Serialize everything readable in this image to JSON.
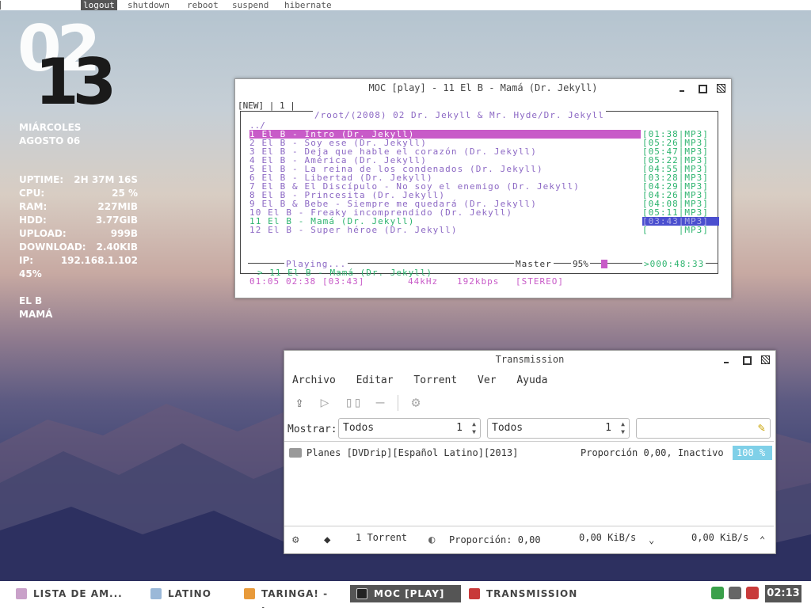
{
  "topbar": {
    "items": [
      {
        "label": "logout",
        "active": true
      },
      {
        "label": "shutdown",
        "active": false
      },
      {
        "label": "reboot",
        "active": false
      },
      {
        "label": "suspend",
        "active": false
      },
      {
        "label": "hibernate",
        "active": false
      }
    ]
  },
  "conky": {
    "hour": "02",
    "minute": "13",
    "weekday": "MIÁRCOLES",
    "date": "AGOSTO 06",
    "stats": [
      {
        "key": "UPTIME:",
        "value": "2H 37M 16S"
      },
      {
        "key": "CPU:",
        "value": "25 %"
      },
      {
        "key": "RAM:",
        "value": "227MIB"
      },
      {
        "key": "HDD:",
        "value": "3.77GIB"
      },
      {
        "key": "UPLOAD:",
        "value": "999B"
      },
      {
        "key": "DOWNLOAD:",
        "value": "2.40KIB"
      },
      {
        "key": "IP:",
        "value": "192.168.1.102"
      }
    ],
    "volume": "45%",
    "artist": "EL B",
    "song": "MAMÁ"
  },
  "moc": {
    "title": "MOC [play] - 11 El B - Mamá (Dr. Jekyll)",
    "header_left": "[NEW] | 1 |",
    "path": "/root/(2008) 02 Dr. Jekyll & Mr. Hyde/Dr. Jekyll",
    "parent_dir": "../",
    "tracks": [
      {
        "name": "1 El B - Intro (Dr. Jekyll)",
        "info": "[01:38|MP3]",
        "state": "selected"
      },
      {
        "name": "2 El B - Soy ese (Dr. Jekyll)",
        "info": "[05:26|MP3]",
        "state": ""
      },
      {
        "name": "3 El B - Deja que hable el corazón (Dr. Jekyll)",
        "info": "[05:47|MP3]",
        "state": ""
      },
      {
        "name": "4 El B - América (Dr. Jekyll)",
        "info": "[05:22|MP3]",
        "state": ""
      },
      {
        "name": "5 El B - La reina de los condenados (Dr. Jekyll)",
        "info": "[04:55|MP3]",
        "state": ""
      },
      {
        "name": "6 El B - Libertad (Dr. Jekyll)",
        "info": "[03:28|MP3]",
        "state": ""
      },
      {
        "name": "7 El B & El Discípulo - No soy el enemigo (Dr. Jekyll)",
        "info": "[04:29|MP3]",
        "state": ""
      },
      {
        "name": "8 El B - Princesita (Dr. Jekyll)",
        "info": "[04:26|MP3]",
        "state": ""
      },
      {
        "name": "9 El B & Bebe - Siempre me quedará (Dr. Jekyll)",
        "info": "[04:08|MP3]",
        "state": ""
      },
      {
        "name": "10 El B - Freaky incomprendido (Dr. Jekyll)",
        "info": "[05:11|MP3]",
        "state": ""
      },
      {
        "name": "11 El B - Mamá (Dr. Jekyll)",
        "info": "[03:43|MP3]",
        "state": "playing"
      },
      {
        "name": "12 El B - Super héroe (Dr. Jekyll)",
        "info": "[     |MP3]",
        "state": ""
      }
    ],
    "playing_label": "Playing...",
    "master_label": "Master",
    "master_percent": "95%",
    "total_time": ">000:48:33",
    "now_playing": "> 11 El B - Mamá (Dr. Jekyll)",
    "time_elapsed": "01:05",
    "time_left": "02:38",
    "time_total": "[03:43]",
    "frequency": "44kHz",
    "bitrate": "192kbps",
    "mode": "[STEREO]"
  },
  "transmission": {
    "title": "Transmission",
    "menu": [
      "Archivo",
      "Editar",
      "Torrent",
      "Ver",
      "Ayuda"
    ],
    "show_label": "Mostrar:",
    "filter1": {
      "value": "Todos",
      "count": "1"
    },
    "filter2": {
      "value": "Todos",
      "count": "1"
    },
    "search_value": "",
    "torrent": {
      "name": "Planes [DVDrip][Español Latino][2013]",
      "status": "Proporción 0,00, Inactivo",
      "percent": "100 %"
    },
    "torrent_count": "1 Torrent",
    "ratio_label": "Proporción: 0,00",
    "down_speed": "0,00 KiB/s",
    "up_speed": "0,00 KiB/s"
  },
  "taskbar": {
    "tasks": [
      {
        "label": "LISTA DE AM...",
        "active": false
      },
      {
        "label": "LATINO",
        "active": false
      },
      {
        "label": "TARINGA! - I...",
        "active": false
      },
      {
        "label": "MOC [PLAY] ...",
        "active": true
      },
      {
        "label": "TRANSMISSION",
        "active": false
      }
    ],
    "clock": "02:13"
  },
  "colors": {
    "accent_magenta": "#c85bc8",
    "track_purple": "#8c68c4",
    "info_green": "#2eb46f",
    "playing_blue": "#4b4fcf",
    "progress_cyan": "#7fd0e8"
  }
}
